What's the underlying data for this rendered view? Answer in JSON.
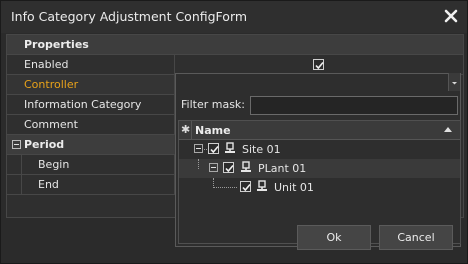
{
  "window": {
    "title": "Info Category Adjustment ConfigForm"
  },
  "grid": {
    "category_properties": "Properties",
    "rows": {
      "enabled": {
        "label": "Enabled",
        "checked": true
      },
      "controller": {
        "label": "Controller"
      },
      "information_category": {
        "label": "Information Category"
      },
      "comment": {
        "label": "Comment"
      }
    },
    "category_period": "Period",
    "period_rows": {
      "begin": {
        "label": "Begin"
      },
      "end": {
        "label": "End"
      }
    }
  },
  "dropdown": {
    "filter_label": "Filter mask:",
    "filter_value": "",
    "tree_header": {
      "star": "✱",
      "name": "Name"
    },
    "tree_items": [
      {
        "label": "Site 01",
        "checked": true,
        "icon": "server-icon"
      },
      {
        "label": "PLant 01",
        "checked": true,
        "icon": "server-icon"
      },
      {
        "label": "Unit 01",
        "checked": true,
        "icon": "server-icon"
      }
    ],
    "ok_label": "Ok",
    "cancel_label": "Cancel"
  },
  "colors": {
    "selected_text": "#e8a21a",
    "background": "#2b2b2b",
    "border": "#474747"
  }
}
